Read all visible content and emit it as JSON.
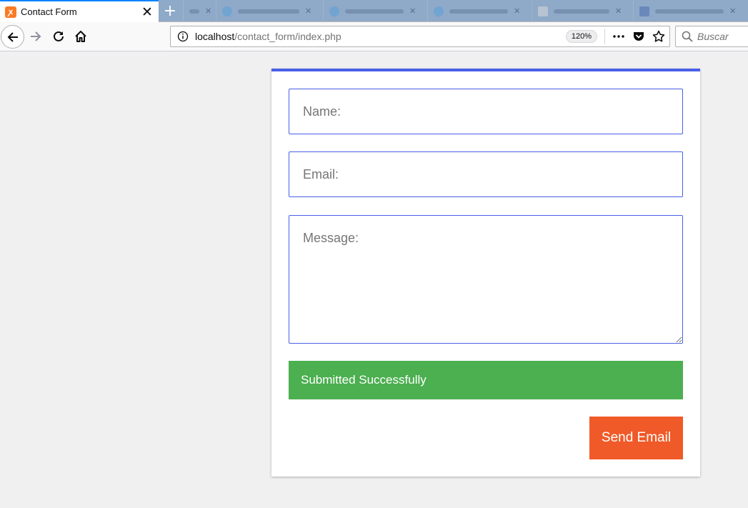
{
  "browser": {
    "tab": {
      "title": "Contact Form",
      "favicon": "xampp-icon",
      "close": "✕"
    },
    "new_tab": "+",
    "url": {
      "host": "localhost",
      "path": "/contact_form/index.php"
    },
    "zoom": "120%",
    "search_placeholder": "Buscar"
  },
  "form": {
    "name_placeholder": "Name:",
    "email_placeholder": "Email:",
    "message_placeholder": "Message:",
    "success_message": "Submitted Successfully",
    "submit_label": "Send Email"
  },
  "colors": {
    "accent": "#4a5fe8",
    "success": "#4caf50",
    "button": "#f05a28",
    "background": "#f0f0f0"
  }
}
